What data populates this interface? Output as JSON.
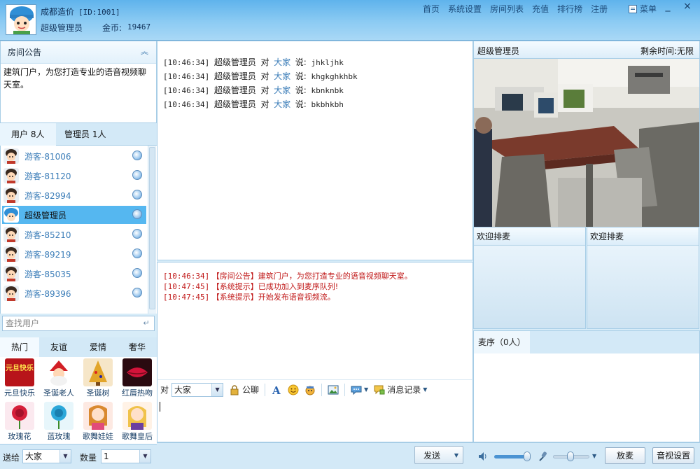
{
  "header": {
    "room_name": "成都造价",
    "room_id": "[ID:1001]",
    "user_role": "超级管理员",
    "coin_label": "金币:",
    "coin_value": "19467",
    "nav": [
      "首页",
      "系统设置",
      "房间列表",
      "充值",
      "排行榜",
      "注册"
    ],
    "menu_label": "菜单",
    "win_controls": [
      "_",
      "×"
    ]
  },
  "notice": {
    "title": "房间公告",
    "text": "建筑门户，为您打造专业的语音视频聊天室。"
  },
  "user_tabs": {
    "users": "用户 8人",
    "admins": "管理员 1人"
  },
  "users": [
    {
      "name": "游客-81006",
      "selected": false,
      "type": "guest"
    },
    {
      "name": "游客-81120",
      "selected": false,
      "type": "guest"
    },
    {
      "name": "游客-82994",
      "selected": false,
      "type": "guest"
    },
    {
      "name": "超级管理员",
      "selected": true,
      "type": "admin"
    },
    {
      "name": "游客-85210",
      "selected": false,
      "type": "guest"
    },
    {
      "name": "游客-89219",
      "selected": false,
      "type": "guest"
    },
    {
      "name": "游客-85035",
      "selected": false,
      "type": "guest"
    },
    {
      "name": "游客-89396",
      "selected": false,
      "type": "guest"
    }
  ],
  "user_search": {
    "placeholder": "查找用户"
  },
  "gift_tabs": [
    "热门",
    "友谊",
    "爱情",
    "奢华"
  ],
  "gifts": [
    {
      "label": "元旦快乐",
      "icon": "new-year-icon",
      "text": "元旦快乐"
    },
    {
      "label": "圣诞老人",
      "icon": "santa-icon"
    },
    {
      "label": "圣诞树",
      "icon": "christmas-tree-icon"
    },
    {
      "label": "红唇热吻",
      "icon": "red-lips-icon"
    },
    {
      "label": "玫瑰花",
      "icon": "rose-icon"
    },
    {
      "label": "蓝玫瑰",
      "icon": "blue-rose-icon"
    },
    {
      "label": "歌舞娃娃",
      "icon": "dancer-doll-icon"
    },
    {
      "label": "歌舞皇后",
      "icon": "dance-queen-icon"
    }
  ],
  "send_bar": {
    "send_to_label": "送给",
    "send_to_value": "大家",
    "qty_label": "数量",
    "qty_value": "1"
  },
  "chat": {
    "messages": [
      {
        "time": "[10:46:34]",
        "from": "超级管理员",
        "to_word": "对",
        "to": "大家",
        "say": "说:",
        "text": "jhkljhk"
      },
      {
        "time": "[10:46:34]",
        "from": "超级管理员",
        "to_word": "对",
        "to": "大家",
        "say": "说:",
        "text": "khgkghkhbk"
      },
      {
        "time": "[10:46:34]",
        "from": "超级管理员",
        "to_word": "对",
        "to": "大家",
        "say": "说:",
        "text": "kbnknbk"
      },
      {
        "time": "[10:46:34]",
        "from": "超级管理员",
        "to_word": "对",
        "to": "大家",
        "say": "说:",
        "text": "bkbhkbh"
      }
    ],
    "system_messages": [
      {
        "time": "[10:46:34]",
        "text": "【房间公告】建筑门户，为您打造专业的语音视频聊天室。"
      },
      {
        "time": "[10:47:45]",
        "text": "【系统提示】已成功加入到麦序队列!"
      },
      {
        "time": "[10:47:45]",
        "text": "【系统提示】开始发布语音视频流。"
      }
    ]
  },
  "input_toolbar": {
    "to_label": "对",
    "to_value": "大家",
    "public_label": "公聊",
    "history_label": "消息记录"
  },
  "send_button": "发送",
  "video": {
    "user": "超级管理员",
    "remain_time": "剩余时间:无限"
  },
  "queue": [
    "欢迎排麦",
    "欢迎排麦"
  ],
  "mic_list": {
    "title": "麦序（0人）"
  },
  "av_bar": {
    "release_mic": "放麦",
    "av_settings": "音视设置"
  },
  "colors": {
    "header_gradient_top": "#5fb3ec",
    "selected_row": "#55b7f0",
    "system_text": "#c01818",
    "link_blue": "#3b7db8"
  }
}
